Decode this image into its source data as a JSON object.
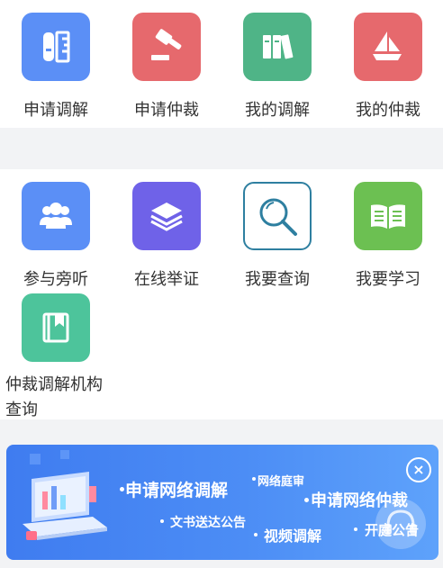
{
  "row1": [
    {
      "label": "申请调解",
      "color": "#5b8ff6",
      "icon": "document-ruler-icon"
    },
    {
      "label": "申请仲裁",
      "color": "#e6696d",
      "icon": "gavel-icon"
    },
    {
      "label": "我的调解",
      "color": "#4fb487",
      "icon": "books-icon"
    },
    {
      "label": "我的仲裁",
      "color": "#e6696d",
      "icon": "sailboat-icon"
    }
  ],
  "row2": [
    {
      "label": "参与旁听",
      "color": "#5b8ff6",
      "icon": "people-icon"
    },
    {
      "label": "在线举证",
      "color": "#6f62e8",
      "icon": "layers-icon"
    },
    {
      "label": "我要查询",
      "color": "#ffffff",
      "icon": "magnifier-icon"
    },
    {
      "label": "我要学习",
      "color": "#6cc052",
      "icon": "open-book-icon"
    }
  ],
  "row3": [
    {
      "label": "仲裁调解机构查询",
      "color": "#4dc49b",
      "icon": "bookmark-book-icon"
    }
  ],
  "banner": {
    "items": [
      "申请网络调解",
      "网络庭审",
      "申请网络仲裁",
      "文书送达公告",
      "视频调解",
      "开庭公告"
    ],
    "close": "×"
  }
}
